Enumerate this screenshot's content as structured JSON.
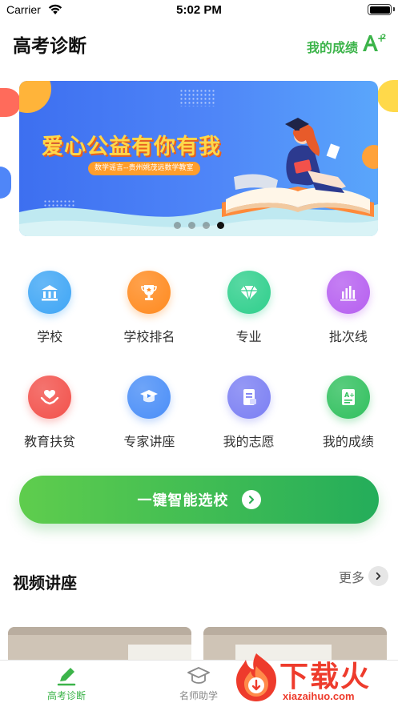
{
  "status_bar": {
    "carrier": "Carrier",
    "time": "5:02 PM"
  },
  "header": {
    "title": "高考诊断",
    "scores_label": "我的成绩",
    "scores_icon": "a-plus-icon"
  },
  "banner": {
    "headline": "爱心公益有你有我",
    "subline": "数学谣言--贵州姚茂远数学教室",
    "page_count": 4,
    "active_page": 4
  },
  "grid": [
    {
      "label": "学校",
      "icon": "school-icon",
      "color": "#3fa6f5"
    },
    {
      "label": "学校排名",
      "icon": "trophy-icon",
      "color": "#ff8a1f"
    },
    {
      "label": "专业",
      "icon": "diamond-icon",
      "color": "#2fcf8c"
    },
    {
      "label": "批次线",
      "icon": "bar-chart-icon",
      "color": "#b65ff0"
    },
    {
      "label": "教育扶贫",
      "icon": "heart-hands-icon",
      "color": "#f2514b"
    },
    {
      "label": "专家讲座",
      "icon": "graduation-play-icon",
      "color": "#4a8ef7"
    },
    {
      "label": "我的志愿",
      "icon": "document-icon",
      "color": "#7b7ff3"
    },
    {
      "label": "我的成绩",
      "icon": "grade-sheet-icon",
      "color": "#31c05e"
    }
  ],
  "cta": {
    "label": "一键智能选校"
  },
  "video_section": {
    "title": "视频讲座",
    "more_label": "更多"
  },
  "tab_bar": [
    {
      "label": "高考诊断",
      "icon": "pencil-icon",
      "active": true
    },
    {
      "label": "名师助学",
      "icon": "mortarboard-icon",
      "active": false
    }
  ],
  "watermark": {
    "text": "下载火",
    "url": "xiazaihuo.com"
  },
  "colors": {
    "accent_green": "#3cb44a",
    "banner_blue": "#4f86f8",
    "headline_yellow": "#ffd84a",
    "watermark_red": "#ee3b2c"
  }
}
